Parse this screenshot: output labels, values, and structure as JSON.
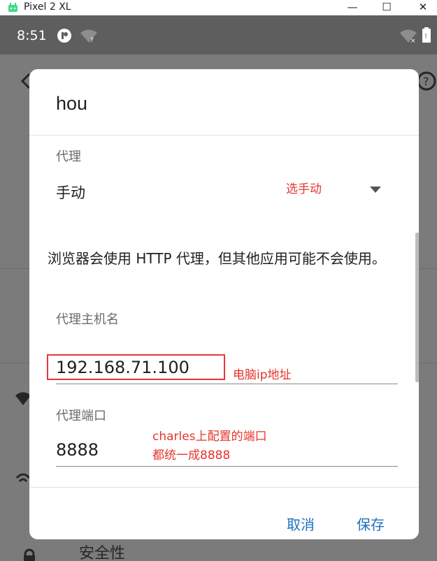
{
  "window": {
    "title": "Pixel 2 XL",
    "minimize": "—",
    "maximize": "☐",
    "close": "✕"
  },
  "statusbar": {
    "time": "8:51",
    "wifi_unknown": "?"
  },
  "background": {
    "security_label": "安全性"
  },
  "dialog": {
    "title": "hou",
    "proxy_label": "代理",
    "proxy_value": "手动",
    "proxy_note": "选手动",
    "description": "浏览器会使用 HTTP 代理，但其他应用可能不会使用。",
    "host_label": "代理主机名",
    "host_value": "192.168.71.100",
    "host_note": "电脑ip地址",
    "port_label": "代理端口",
    "port_value": "8888",
    "port_note_line1": "charles上配置的端口",
    "port_note_line2": "都统一成8888",
    "cancel": "取消",
    "save": "保存"
  },
  "colors": {
    "accent": "#1f6fbf",
    "annotation": "#e5352d",
    "scrim": "#7b7b7b"
  }
}
